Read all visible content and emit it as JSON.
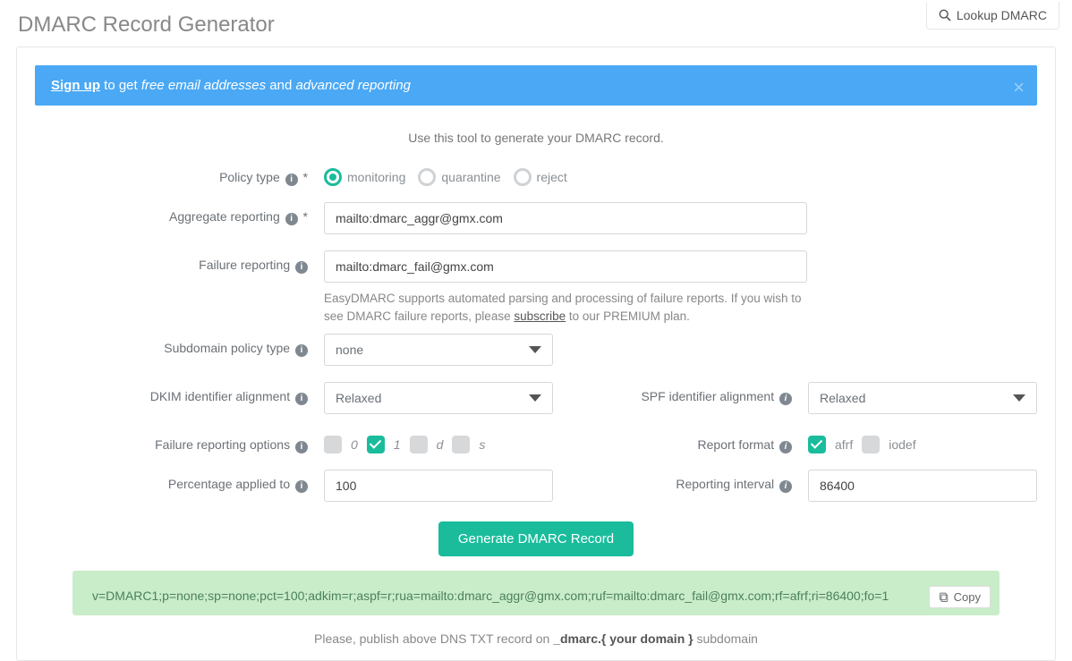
{
  "header": {
    "title": "DMARC Record Generator",
    "lookup_btn": "Lookup DMARC"
  },
  "alert": {
    "signup": "Sign up",
    "mid1": " to get ",
    "free_email": "free email addresses",
    "mid2": " and ",
    "adv_rep": "advanced reporting"
  },
  "lead": "Use this tool to generate your DMARC record.",
  "labels": {
    "policy_type": "Policy type",
    "aggregate": "Aggregate reporting",
    "failure": "Failure reporting",
    "subdomain": "Subdomain policy type",
    "dkim": "DKIM identifier alignment",
    "spf": "SPF identifier alignment",
    "fo": "Failure reporting options",
    "rf": "Report format",
    "pct": "Percentage applied to",
    "ri": "Reporting interval"
  },
  "policy": {
    "monitoring": "monitoring",
    "quarantine": "quarantine",
    "reject": "reject"
  },
  "values": {
    "rua": "mailto:dmarc_aggr@gmx.com",
    "ruf": "mailto:dmarc_fail@gmx.com",
    "sp": "none",
    "dkim": "Relaxed",
    "spf": "Relaxed",
    "pct": "100",
    "ri": "86400"
  },
  "fo": {
    "o0": "0",
    "o1": "1",
    "od": "d",
    "os": "s"
  },
  "rf": {
    "afrf": "afrf",
    "iodef": "iodef"
  },
  "help": {
    "failure_pre": "EasyDMARC supports automated parsing and processing of failure reports. If you wish to see DMARC failure reports, please ",
    "subscribe": "subscribe",
    "failure_post": " to our PREMIUM plan."
  },
  "buttons": {
    "generate": "Generate DMARC Record",
    "copy": "Copy"
  },
  "result": "v=DMARC1;p=none;sp=none;pct=100;adkim=r;aspf=r;rua=mailto:dmarc_aggr@gmx.com;ruf=mailto:dmarc_fail@gmx.com;rf=afrf;ri=86400;fo=1",
  "publish": {
    "pre": "Please, publish above DNS TXT record on ",
    "host": "_dmarc.{ your domain }",
    "post": " subdomain"
  }
}
